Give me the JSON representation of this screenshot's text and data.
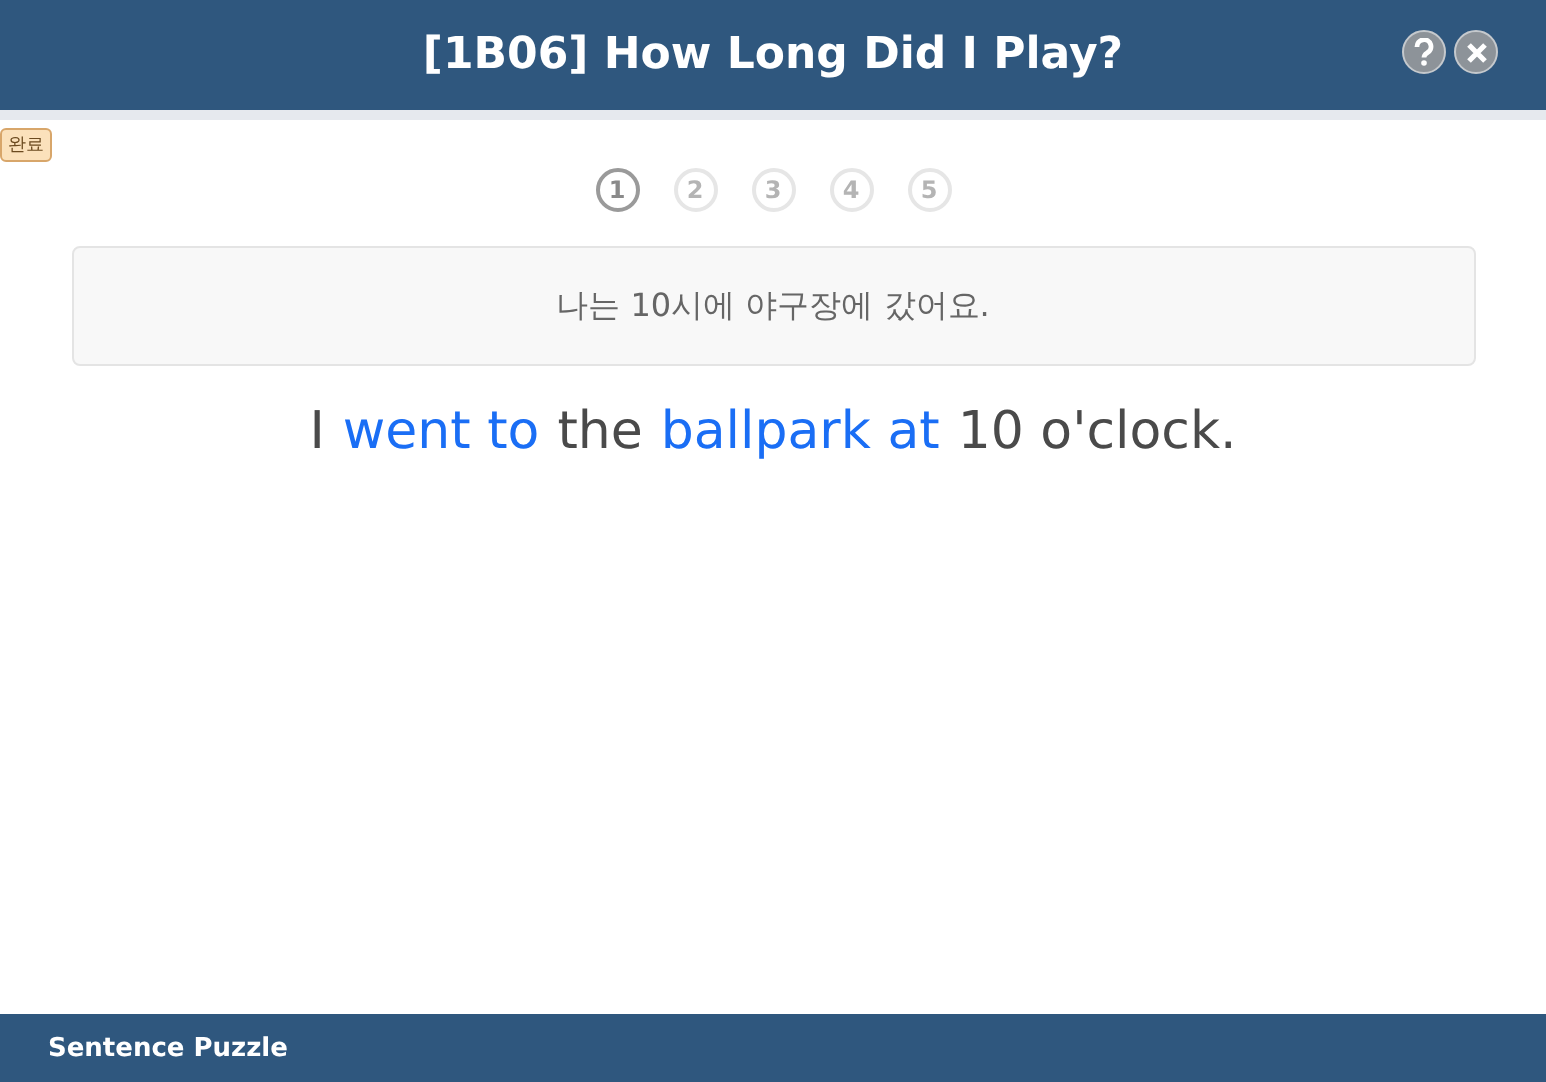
{
  "window": {
    "title": "[1B06] How Long Did I Play?"
  },
  "badge": "완료",
  "steps": [
    {
      "label": "1",
      "selected": true
    },
    {
      "label": "2",
      "selected": false
    },
    {
      "label": "3",
      "selected": false
    },
    {
      "label": "4",
      "selected": false
    },
    {
      "label": "5",
      "selected": false
    }
  ],
  "prompt": "나는 10시에 야구장에 갔어요.",
  "sentence": [
    {
      "text": "I",
      "highlighted": false
    },
    {
      "text": "went to",
      "highlighted": true
    },
    {
      "text": "the",
      "highlighted": false
    },
    {
      "text": "ballpark at",
      "highlighted": true
    },
    {
      "text": "10 o'clock.",
      "highlighted": false
    }
  ],
  "footer": "Sentence Puzzle"
}
